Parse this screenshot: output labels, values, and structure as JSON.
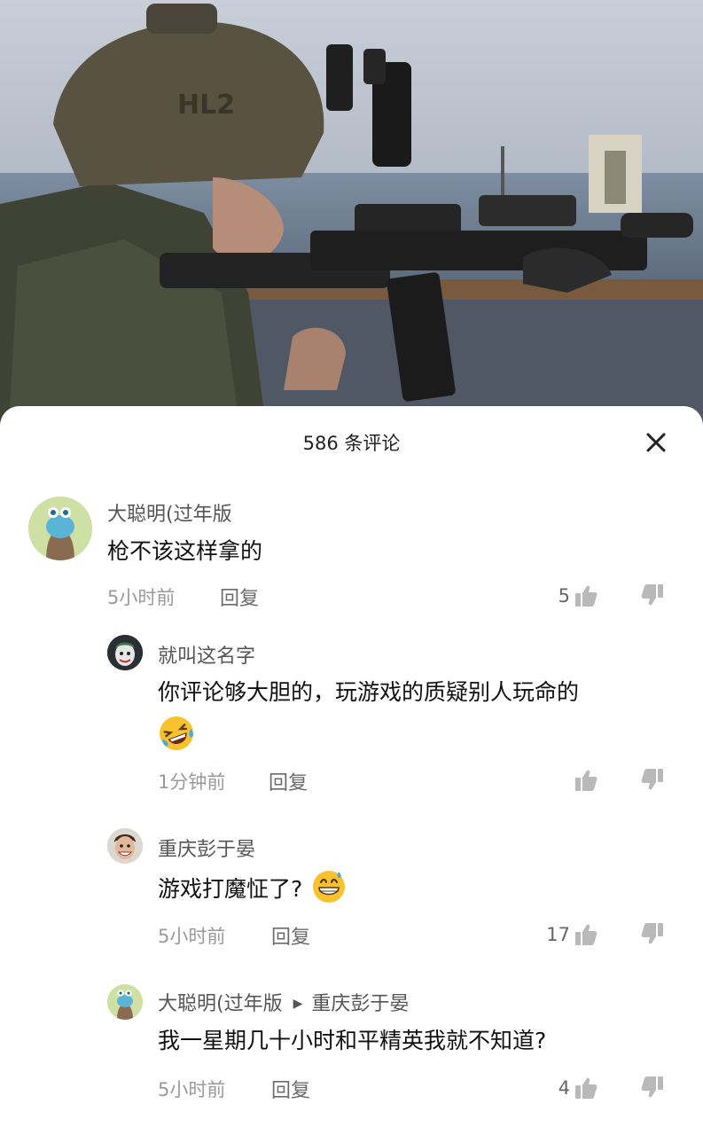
{
  "video": {
    "helmet_text": "HL2"
  },
  "sheet": {
    "title": "586 条评论"
  },
  "comments": [
    {
      "user": "大聪明(过年版",
      "text": "枪不该这样拿的",
      "time": "5小时前",
      "reply": "回复",
      "likes": "5"
    },
    {
      "user": "就叫这名字",
      "text": "你评论够大胆的，玩游戏的质疑别人玩命的",
      "emoji": "rolling-laughing-emoji",
      "time": "1分钟前",
      "reply": "回复",
      "likes": ""
    },
    {
      "user": "重庆彭于晏",
      "text": "游戏打魔怔了?",
      "emoji": "grinning-sweat-emoji",
      "time": "5小时前",
      "reply": "回复",
      "likes": "17"
    },
    {
      "user": "大聪明(过年版",
      "reply_to": "重庆彭于晏",
      "text": "我一星期几十小时和平精英我就不知道?",
      "time": "5小时前",
      "reply": "回复",
      "likes": "4"
    }
  ],
  "colors": {
    "sheet": "#ffffff",
    "meta_text": "#9a9a9a",
    "emoji_yellow": "#f8c22c"
  }
}
